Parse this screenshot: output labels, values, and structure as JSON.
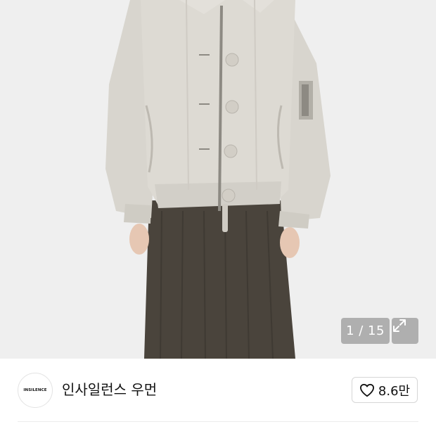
{
  "gallery": {
    "current": 1,
    "total": 15,
    "pager_text": "1 / 15",
    "expand_icon": "expand-icon",
    "image_alt": "product-photo-bomber-jacket"
  },
  "store": {
    "logo_text": "INSILENCE",
    "name": "인사일런스 우먼",
    "like_icon": "heart-outline-icon",
    "like_count": "8.6만"
  },
  "colors": {
    "background": "#efefef",
    "jacket": "#dddad3",
    "skirt": "#4a443c",
    "pager_bg": "#969696"
  }
}
